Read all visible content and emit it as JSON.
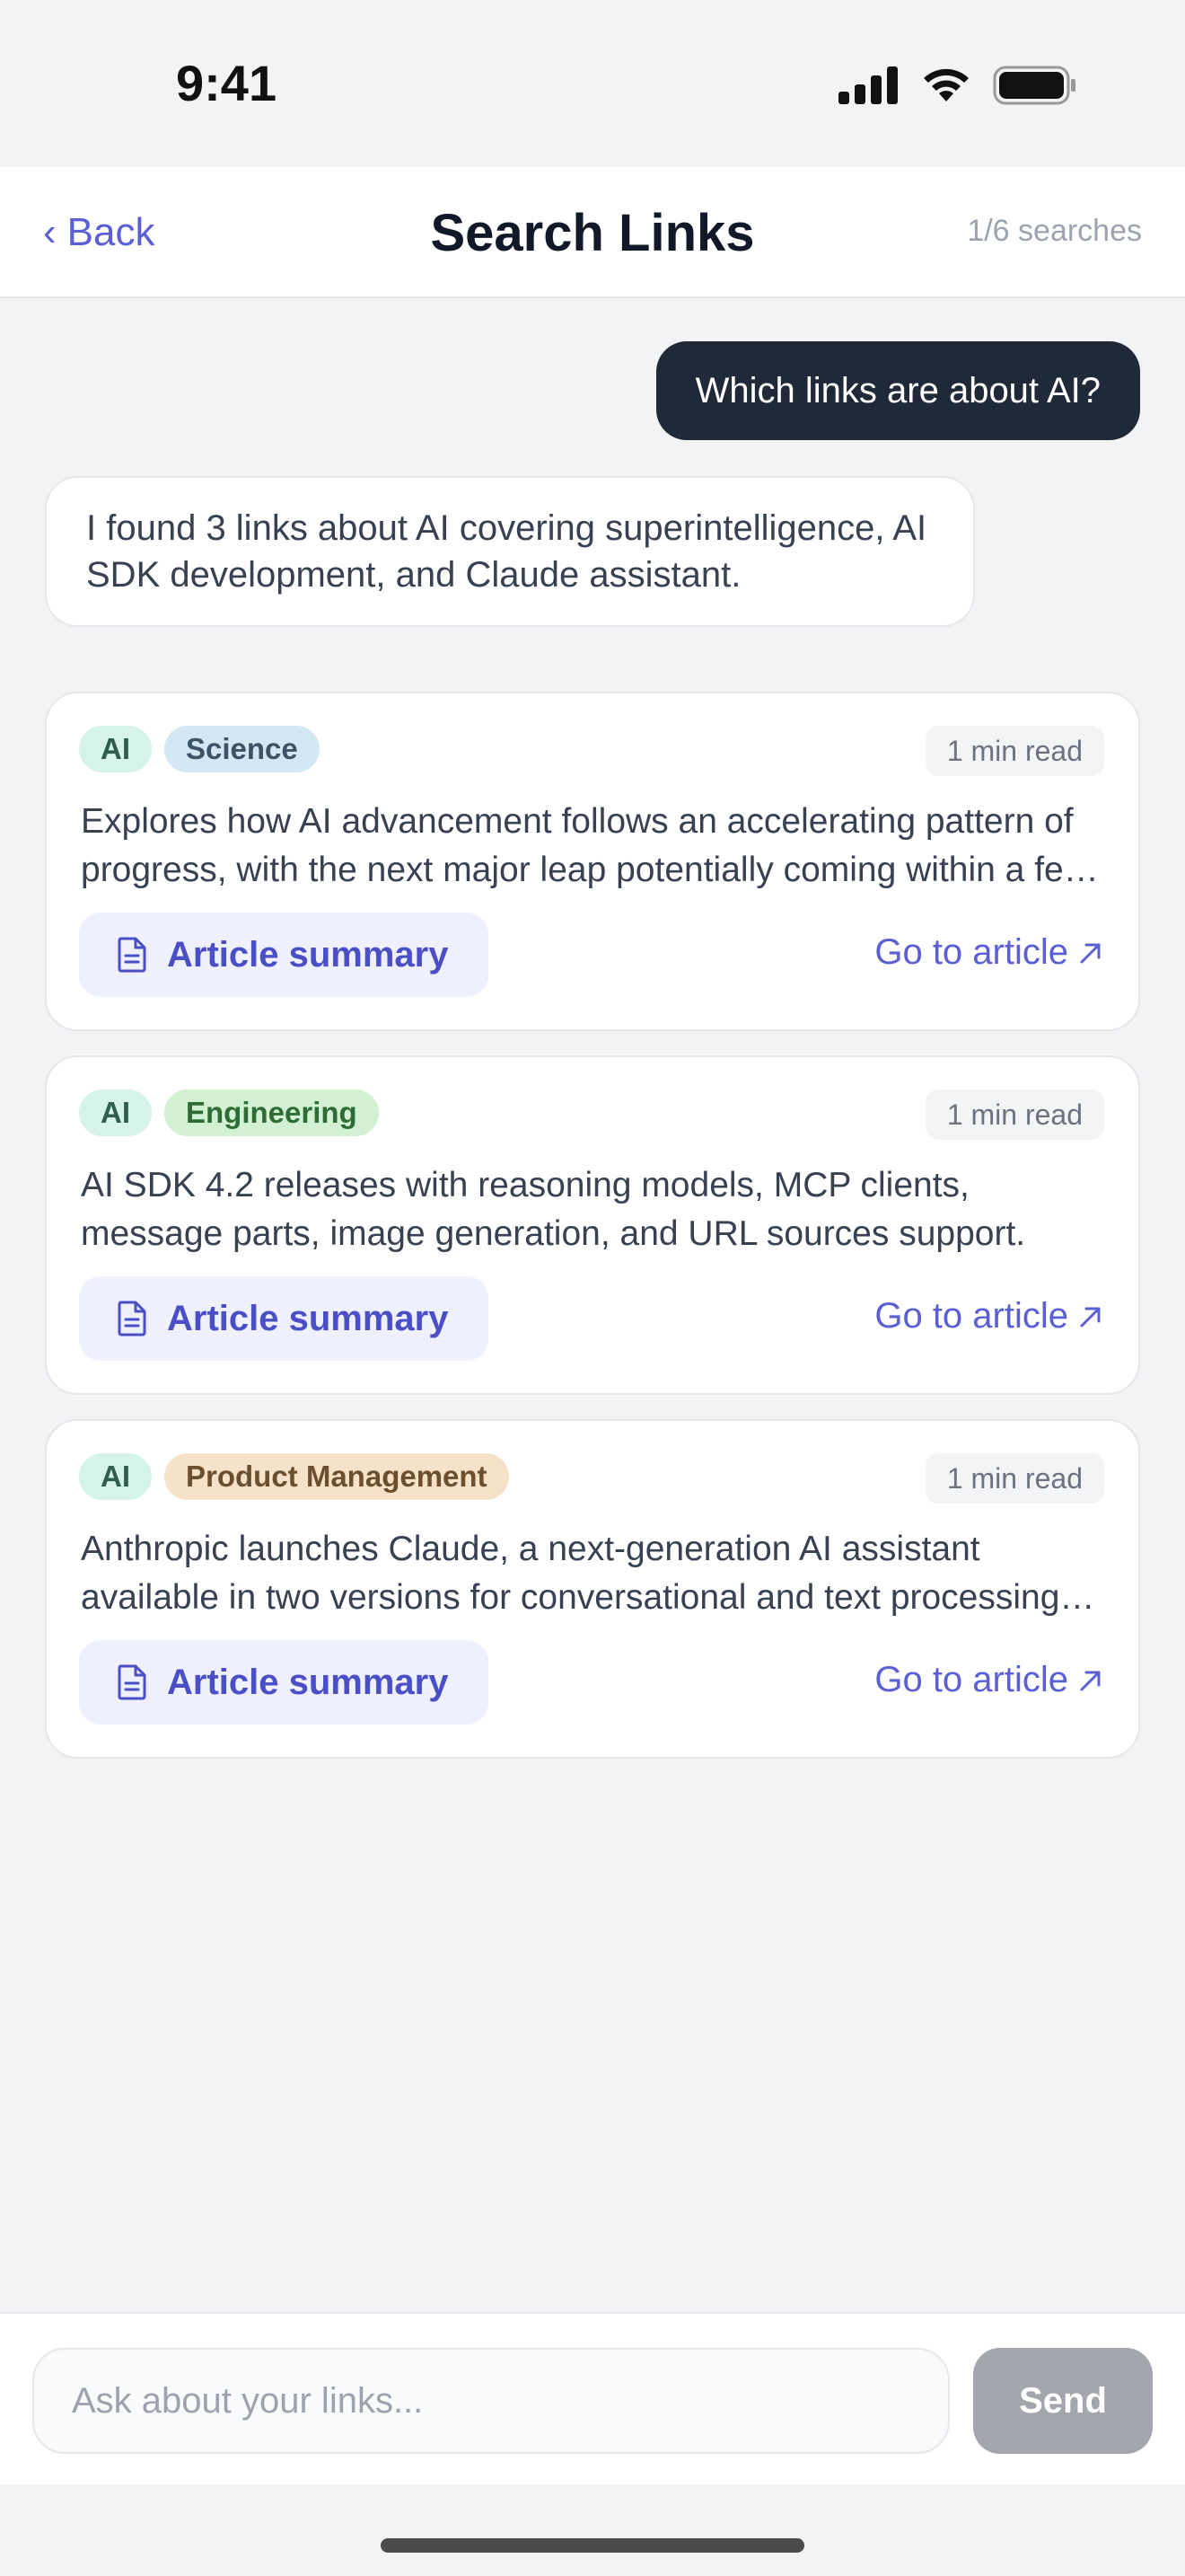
{
  "status": {
    "time": "9:41",
    "icons": [
      "signal-icon",
      "wifi-icon",
      "battery-icon"
    ]
  },
  "header": {
    "back_label": "Back",
    "title": "Search Links",
    "search_count": "1/6 searches"
  },
  "conversation": {
    "user_message": "Which links are about AI?",
    "assistant_message": "I found 3 links about AI covering superintelligence, AI SDK development, and Claude assistant."
  },
  "cards": [
    {
      "tags": [
        {
          "label": "AI",
          "bg": "#d6f3ea",
          "color": "#2f5d4f"
        },
        {
          "label": "Science",
          "bg": "#d4e8f3",
          "color": "#3b5566"
        }
      ],
      "read_time": "1 min read",
      "description": "Explores how AI advancement follows an accelerating pattern of progress, with the next major leap potentially coming within a few years.",
      "summary_label": "Article summary",
      "link_label": "Go to article"
    },
    {
      "tags": [
        {
          "label": "AI",
          "bg": "#d6f3ea",
          "color": "#2f5d4f"
        },
        {
          "label": "Engineering",
          "bg": "#d2f0d2",
          "color": "#2f6b34"
        }
      ],
      "read_time": "1 min read",
      "description": "AI SDK 4.2 releases with reasoning models, MCP clients, message parts, image generation, and URL sources support.",
      "summary_label": "Article summary",
      "link_label": "Go to article"
    },
    {
      "tags": [
        {
          "label": "AI",
          "bg": "#d6f3ea",
          "color": "#2f5d4f"
        },
        {
          "label": "Product Management",
          "bg": "#f6e2c8",
          "color": "#6b4f2f"
        }
      ],
      "read_time": "1 min read",
      "description": "Anthropic launches Claude, a next-generation AI assistant available in two versions for conversational and text processing tasks.",
      "summary_label": "Article summary",
      "link_label": "Go to article"
    }
  ],
  "input": {
    "placeholder": "Ask about your links...",
    "value": "",
    "send_label": "Send"
  }
}
